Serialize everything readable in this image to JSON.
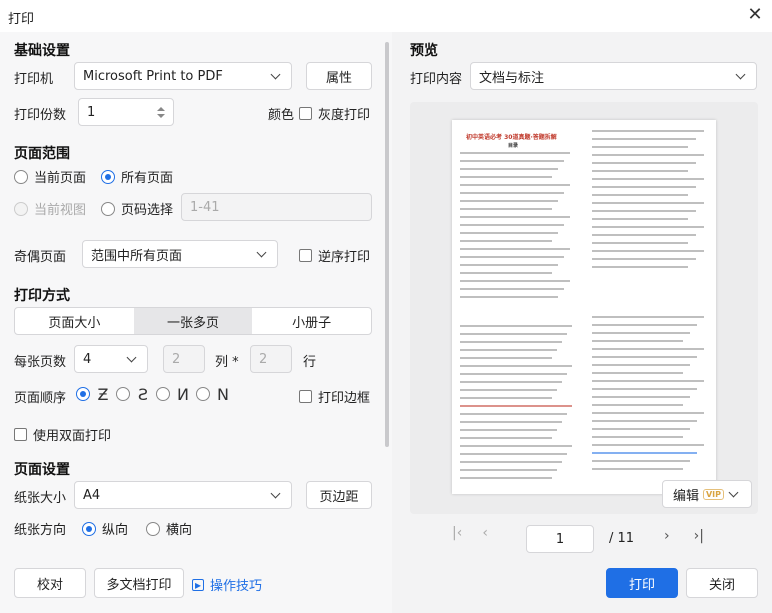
{
  "window": {
    "title": "打印"
  },
  "basic": {
    "section": "基础设置",
    "printer_label": "打印机",
    "printer_value": "Microsoft Print to PDF",
    "properties_btn": "属性",
    "copies_label": "打印份数",
    "copies_value": "1",
    "color_label": "颜色",
    "grayscale_label": "灰度打印"
  },
  "range": {
    "section": "页面范围",
    "current_page": "当前页面",
    "all_pages": "所有页面",
    "current_view": "当前视图",
    "page_select": "页码选择",
    "page_select_placeholder": "1-41"
  },
  "oddeven": {
    "label": "奇偶页面",
    "value": "范围中所有页面",
    "reverse_label": "逆序打印"
  },
  "method": {
    "section": "打印方式",
    "tabs": [
      "页面大小",
      "一张多页",
      "小册子"
    ],
    "per_sheet_label": "每张页数",
    "per_sheet_value": "4",
    "cols_value": "2",
    "cols_label": "列 *",
    "rows_value": "2",
    "rows_label": "行",
    "order_label": "页面顺序",
    "border_label": "打印边框",
    "duplex_label": "使用双面打印"
  },
  "pagesetup": {
    "section": "页面设置",
    "paper_label": "纸张大小",
    "paper_value": "A4",
    "margins_btn": "页边距",
    "orientation_label": "纸张方向",
    "portrait": "纵向",
    "landscape": "横向"
  },
  "footer_left": {
    "proof_btn": "校对",
    "multi_btn": "多文档打印",
    "tips_link": "操作技巧"
  },
  "preview": {
    "section": "预览",
    "content_label": "打印内容",
    "content_value": "文档与标注",
    "edit_btn": "编辑",
    "vip": "VIP",
    "doc_title": "初中英语必考 30道真题·答题拆解",
    "doc_sub": "目录",
    "current_page": "1",
    "total_pages": "/ 11"
  },
  "footer_right": {
    "print_btn": "打印",
    "close_btn": "关闭"
  },
  "colors": {
    "accent": "#1f6fe5",
    "panel": "#f7f7f8"
  }
}
